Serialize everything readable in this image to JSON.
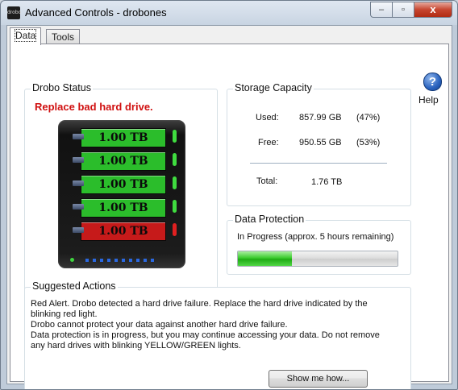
{
  "window": {
    "app_icon_text": "drobo",
    "title": "Advanced Controls - drobones"
  },
  "caption_buttons": {
    "minimize": "–",
    "maximize": "▫",
    "close": "x"
  },
  "tabs": [
    {
      "label": "Data",
      "active": true
    },
    {
      "label": "Tools",
      "active": false
    }
  ],
  "help": {
    "icon": "question-icon",
    "icon_glyph": "?",
    "label": "Help"
  },
  "drobo_status": {
    "title": "Drobo Status",
    "alert": "Replace bad hard drive.",
    "drives": [
      {
        "label": "1.00 TB",
        "state": "ok",
        "color": "#2bbd2b",
        "led": "#3fdc3f"
      },
      {
        "label": "1.00 TB",
        "state": "ok",
        "color": "#2bbd2b",
        "led": "#3fdc3f"
      },
      {
        "label": "1.00 TB",
        "state": "ok",
        "color": "#2bbd2b",
        "led": "#3fdc3f"
      },
      {
        "label": "1.00 TB",
        "state": "ok",
        "color": "#2bbd2b",
        "led": "#3fdc3f"
      },
      {
        "label": "1.00 TB",
        "state": "failed",
        "color": "#c61a1a",
        "led": "#e02020"
      }
    ],
    "capacity_lights": {
      "count": 10,
      "color": "#2a68e0"
    }
  },
  "storage_capacity": {
    "title": "Storage Capacity",
    "used_label": "Used:",
    "used_value": "857.99 GB",
    "used_pct": "(47%)",
    "free_label": "Free:",
    "free_value": "950.55 GB",
    "free_pct": "(53%)",
    "total_label": "Total:",
    "total_value": "1.76 TB"
  },
  "data_protection": {
    "title": "Data Protection",
    "status": "In Progress (approx. 5 hours remaining)",
    "progress": 0.34
  },
  "suggested_actions": {
    "title": "Suggested Actions",
    "lines": [
      "Red Alert. Drobo detected a hard drive failure. Replace the hard drive indicated by the",
      "blinking red light.",
      "Drobo cannot protect your data against another hard drive failure.",
      "Data protection is in progress, but you may continue accessing your data. Do not remove",
      "any hard drives with blinking YELLOW/GREEN lights."
    ],
    "button": "Show me how..."
  }
}
